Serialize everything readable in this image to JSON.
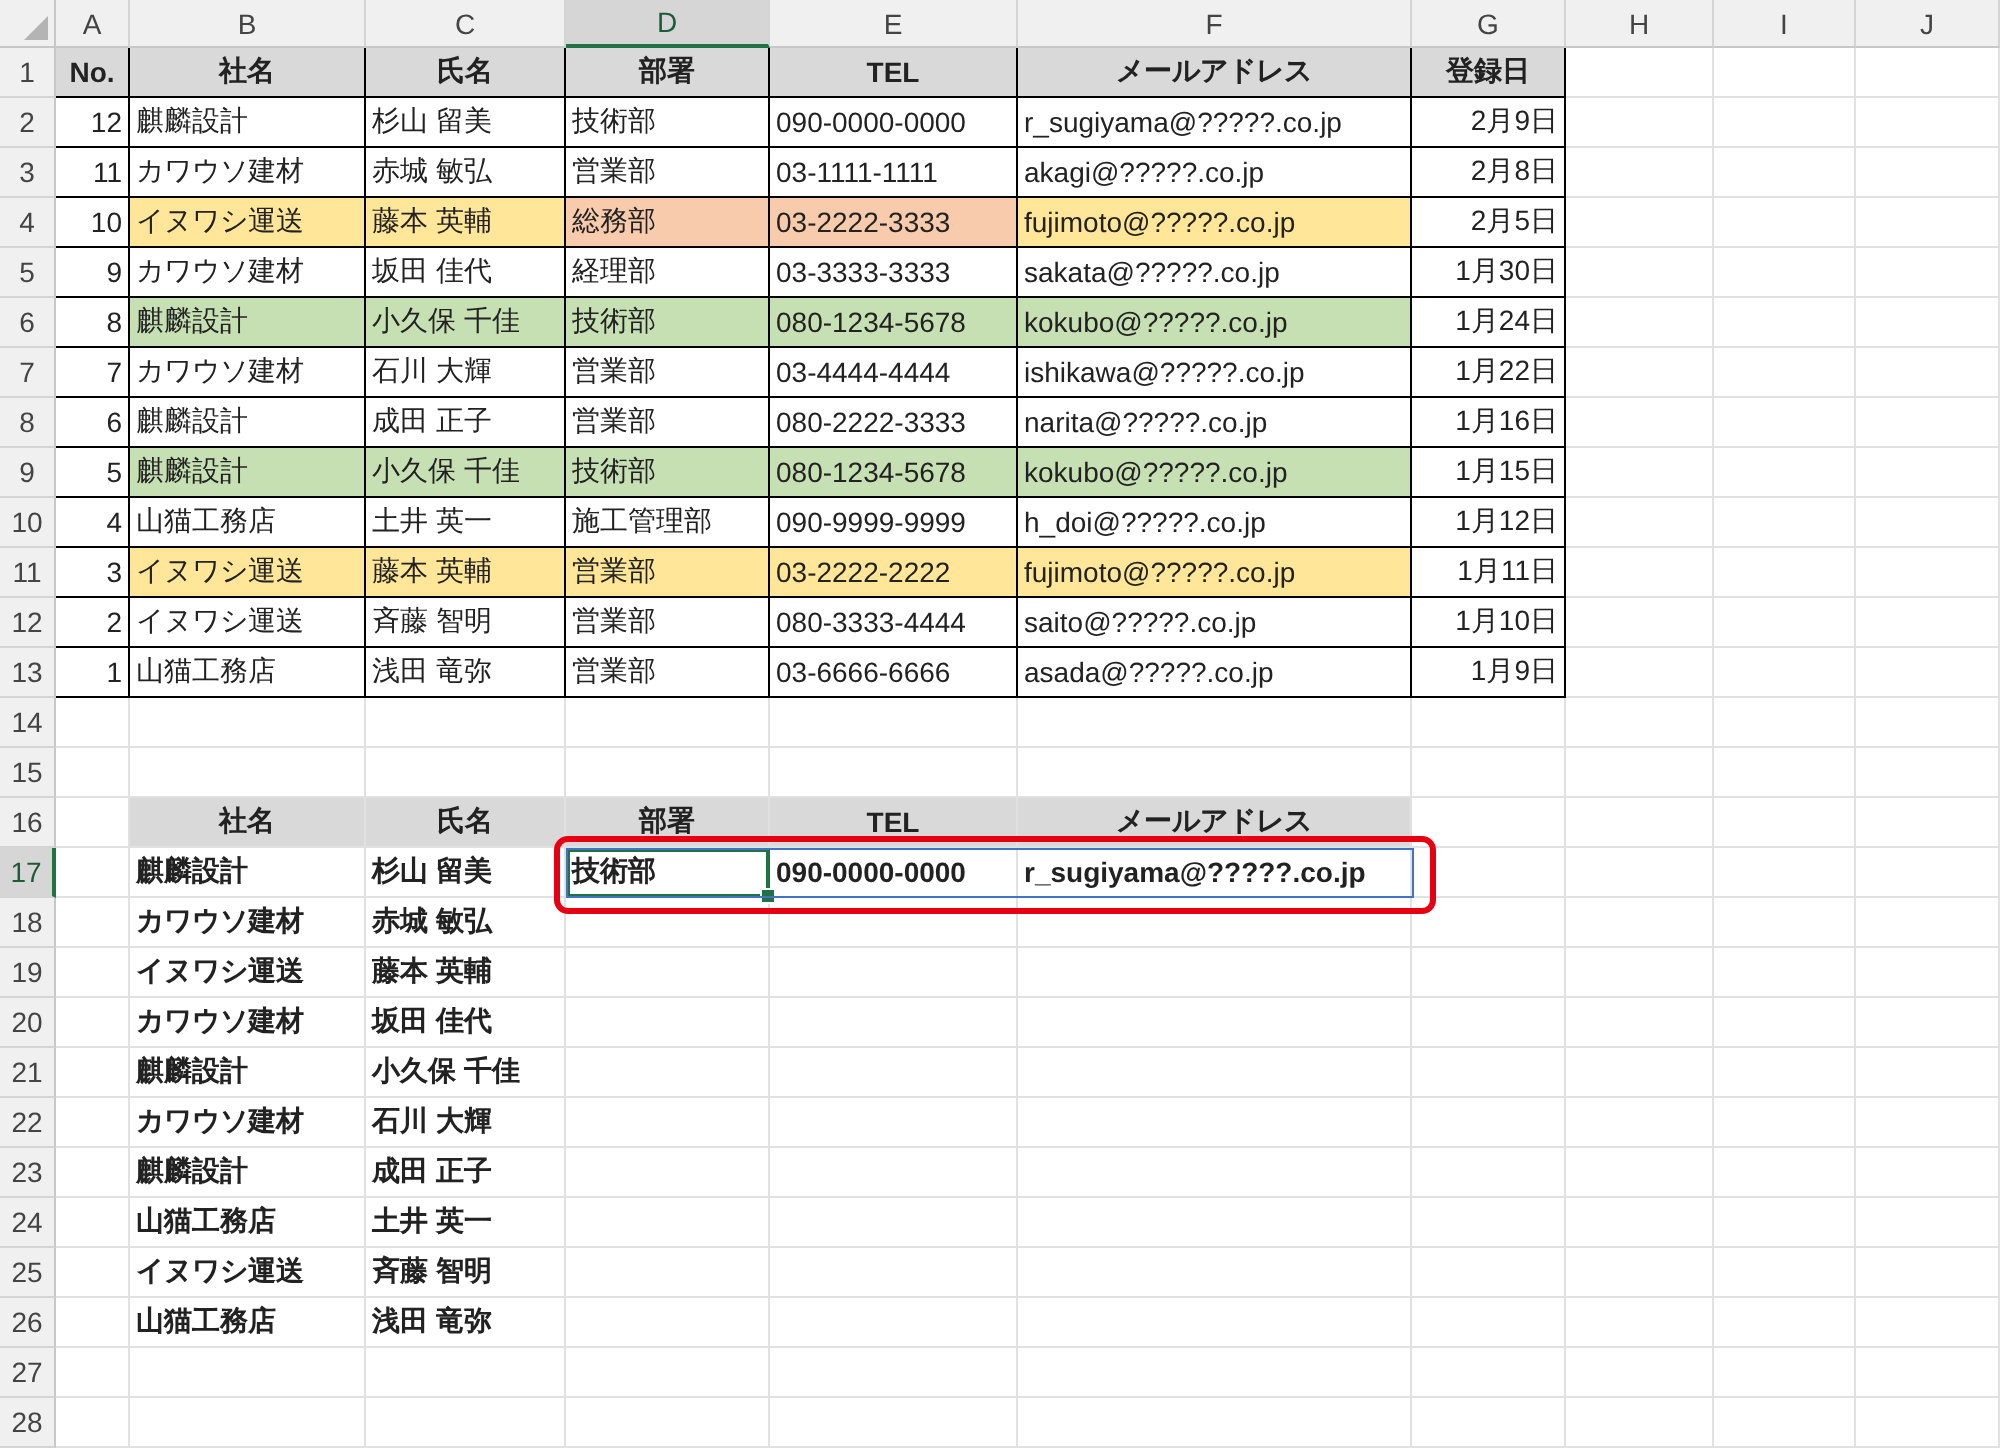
{
  "sheet": {
    "column_headers": [
      {
        "label": "A",
        "selected": false
      },
      {
        "label": "B",
        "selected": false
      },
      {
        "label": "C",
        "selected": false
      },
      {
        "label": "D",
        "selected": true
      },
      {
        "label": "E",
        "selected": false
      },
      {
        "label": "F",
        "selected": false
      },
      {
        "label": "G",
        "selected": false
      },
      {
        "label": "H",
        "selected": false
      },
      {
        "label": "I",
        "selected": false
      },
      {
        "label": "J",
        "selected": false
      }
    ],
    "row_headers": [
      {
        "label": "1",
        "selected": false
      },
      {
        "label": "2",
        "selected": false
      },
      {
        "label": "3",
        "selected": false
      },
      {
        "label": "4",
        "selected": false
      },
      {
        "label": "5",
        "selected": false
      },
      {
        "label": "6",
        "selected": false
      },
      {
        "label": "7",
        "selected": false
      },
      {
        "label": "8",
        "selected": false
      },
      {
        "label": "9",
        "selected": false
      },
      {
        "label": "10",
        "selected": false
      },
      {
        "label": "11",
        "selected": false
      },
      {
        "label": "12",
        "selected": false
      },
      {
        "label": "13",
        "selected": false
      },
      {
        "label": "14",
        "selected": false
      },
      {
        "label": "15",
        "selected": false
      },
      {
        "label": "16",
        "selected": false
      },
      {
        "label": "17",
        "selected": true
      },
      {
        "label": "18",
        "selected": false
      },
      {
        "label": "19",
        "selected": false
      },
      {
        "label": "20",
        "selected": false
      },
      {
        "label": "21",
        "selected": false
      },
      {
        "label": "22",
        "selected": false
      },
      {
        "label": "23",
        "selected": false
      },
      {
        "label": "24",
        "selected": false
      },
      {
        "label": "25",
        "selected": false
      },
      {
        "label": "26",
        "selected": false
      },
      {
        "label": "27",
        "selected": false
      },
      {
        "label": "28",
        "selected": false
      }
    ]
  },
  "table": {
    "columns": [
      "No.",
      "社名",
      "氏名",
      "部署",
      "TEL",
      "メールアドレス",
      "登録日"
    ],
    "rows": [
      {
        "cells": [
          {
            "text": "12"
          },
          {
            "text": "麒麟設計"
          },
          {
            "text": "杉山 留美"
          },
          {
            "text": "技術部"
          },
          {
            "text": "090-0000-0000"
          },
          {
            "text": "r_sugiyama@?????.co.jp"
          },
          {
            "text": "2月9日"
          }
        ]
      },
      {
        "cells": [
          {
            "text": "11"
          },
          {
            "text": "カワウソ建材"
          },
          {
            "text": "赤城 敏弘"
          },
          {
            "text": "営業部"
          },
          {
            "text": "03-1111-1111"
          },
          {
            "text": "akagi@?????.co.jp"
          },
          {
            "text": "2月8日"
          }
        ]
      },
      {
        "cells": [
          {
            "text": "10"
          },
          {
            "text": "イヌワシ運送",
            "color": "#ffe699"
          },
          {
            "text": "藤本 英輔",
            "color": "#ffe699"
          },
          {
            "text": "総務部",
            "color": "#f8cbad"
          },
          {
            "text": "03-2222-3333",
            "color": "#f8cbad"
          },
          {
            "text": "fujimoto@?????.co.jp",
            "color": "#ffe699"
          },
          {
            "text": "2月5日"
          }
        ]
      },
      {
        "cells": [
          {
            "text": "9"
          },
          {
            "text": "カワウソ建材"
          },
          {
            "text": "坂田 佳代"
          },
          {
            "text": "経理部"
          },
          {
            "text": "03-3333-3333"
          },
          {
            "text": "sakata@?????.co.jp"
          },
          {
            "text": "1月30日"
          }
        ]
      },
      {
        "cells": [
          {
            "text": "8"
          },
          {
            "text": "麒麟設計",
            "color": "#c6e0b4"
          },
          {
            "text": "小久保 千佳",
            "color": "#c6e0b4"
          },
          {
            "text": "技術部",
            "color": "#c6e0b4"
          },
          {
            "text": "080-1234-5678",
            "color": "#c6e0b4"
          },
          {
            "text": "kokubo@?????.co.jp",
            "color": "#c6e0b4"
          },
          {
            "text": "1月24日"
          }
        ]
      },
      {
        "cells": [
          {
            "text": "7"
          },
          {
            "text": "カワウソ建材"
          },
          {
            "text": "石川 大輝"
          },
          {
            "text": "営業部"
          },
          {
            "text": "03-4444-4444"
          },
          {
            "text": "ishikawa@?????.co.jp"
          },
          {
            "text": "1月22日"
          }
        ]
      },
      {
        "cells": [
          {
            "text": "6"
          },
          {
            "text": "麒麟設計"
          },
          {
            "text": "成田 正子"
          },
          {
            "text": "営業部"
          },
          {
            "text": "080-2222-3333"
          },
          {
            "text": "narita@?????.co.jp"
          },
          {
            "text": "1月16日"
          }
        ]
      },
      {
        "cells": [
          {
            "text": "5"
          },
          {
            "text": "麒麟設計",
            "color": "#c6e0b4"
          },
          {
            "text": "小久保 千佳",
            "color": "#c6e0b4"
          },
          {
            "text": "技術部",
            "color": "#c6e0b4"
          },
          {
            "text": "080-1234-5678",
            "color": "#c6e0b4"
          },
          {
            "text": "kokubo@?????.co.jp",
            "color": "#c6e0b4"
          },
          {
            "text": "1月15日"
          }
        ]
      },
      {
        "cells": [
          {
            "text": "4"
          },
          {
            "text": "山猫工務店"
          },
          {
            "text": "土井 英一"
          },
          {
            "text": "施工管理部"
          },
          {
            "text": "090-9999-9999"
          },
          {
            "text": "h_doi@?????.co.jp"
          },
          {
            "text": "1月12日"
          }
        ]
      },
      {
        "cells": [
          {
            "text": "3"
          },
          {
            "text": "イヌワシ運送",
            "color": "#ffe699"
          },
          {
            "text": "藤本 英輔",
            "color": "#ffe699"
          },
          {
            "text": "営業部",
            "color": "#ffe699"
          },
          {
            "text": "03-2222-2222",
            "color": "#ffe699"
          },
          {
            "text": "fujimoto@?????.co.jp",
            "color": "#ffe699"
          },
          {
            "text": "1月11日"
          }
        ]
      },
      {
        "cells": [
          {
            "text": "2"
          },
          {
            "text": "イヌワシ運送"
          },
          {
            "text": "斉藤 智明"
          },
          {
            "text": "営業部"
          },
          {
            "text": "080-3333-4444"
          },
          {
            "text": "saito@?????.co.jp"
          },
          {
            "text": "1月10日"
          }
        ]
      },
      {
        "cells": [
          {
            "text": "1"
          },
          {
            "text": "山猫工務店"
          },
          {
            "text": "浅田 竜弥"
          },
          {
            "text": "営業部"
          },
          {
            "text": "03-6666-6666"
          },
          {
            "text": "asada@?????.co.jp"
          },
          {
            "text": "1月9日"
          }
        ]
      }
    ]
  },
  "lookup": {
    "columns": [
      "社名",
      "氏名",
      "部署",
      "TEL",
      "メールアドレス"
    ],
    "rows": [
      [
        "麒麟設計",
        "杉山 留美"
      ],
      [
        "カワウソ建材",
        "赤城 敏弘"
      ],
      [
        "イヌワシ運送",
        "藤本 英輔"
      ],
      [
        "カワウソ建材",
        "坂田 佳代"
      ],
      [
        "麒麟設計",
        "小久保 千佳"
      ],
      [
        "カワウソ建材",
        "石川 大輝"
      ],
      [
        "麒麟設計",
        "成田 正子"
      ],
      [
        "山猫工務店",
        "土井 英一"
      ],
      [
        "イヌワシ運送",
        "斉藤 智明"
      ],
      [
        "山猫工務店",
        "浅田 竜弥"
      ]
    ],
    "result": [
      {
        "text": "技術部",
        "selected": true
      },
      {
        "text": "090-0000-0000",
        "selected": false
      },
      {
        "text": "r_sugiyama@?????.co.jp",
        "selected": false
      }
    ]
  }
}
